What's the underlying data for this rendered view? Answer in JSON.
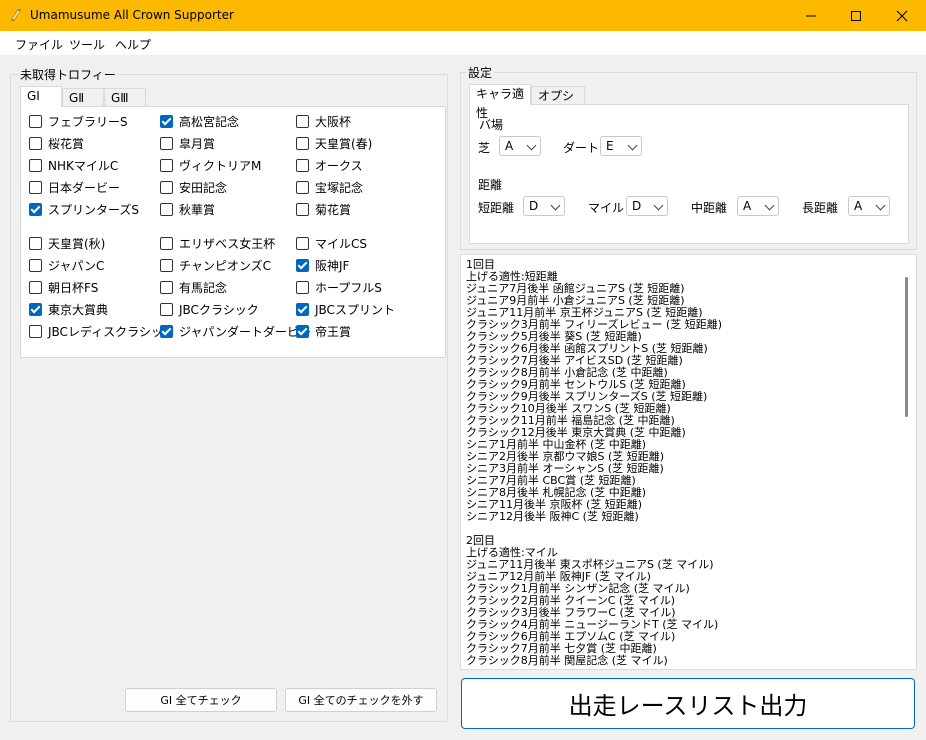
{
  "window": {
    "title": "Umamusume All Crown Supporter"
  },
  "menu": [
    "ファイル",
    "ツール",
    "ヘルプ"
  ],
  "trophy_group": {
    "label": "未取得トロフィー",
    "tabs": [
      "GⅠ",
      "GⅡ",
      "GⅢ"
    ],
    "active_tab": 0,
    "checkboxes": [
      {
        "label": "フェブラリーS",
        "checked": false
      },
      {
        "label": "高松宮記念",
        "checked": true
      },
      {
        "label": "大阪杯",
        "checked": false
      },
      {
        "label": "桜花賞",
        "checked": false
      },
      {
        "label": "皐月賞",
        "checked": false
      },
      {
        "label": "天皇賞(春)",
        "checked": false
      },
      {
        "label": "NHKマイルC",
        "checked": false
      },
      {
        "label": "ヴィクトリアM",
        "checked": false
      },
      {
        "label": "オークス",
        "checked": false
      },
      {
        "label": "日本ダービー",
        "checked": false
      },
      {
        "label": "安田記念",
        "checked": false
      },
      {
        "label": "宝塚記念",
        "checked": false
      },
      {
        "label": "スプリンターズS",
        "checked": true
      },
      {
        "label": "秋華賞",
        "checked": false
      },
      {
        "label": "菊花賞",
        "checked": false
      },
      {
        "label": "天皇賞(秋)",
        "checked": false
      },
      {
        "label": "エリザベス女王杯",
        "checked": false
      },
      {
        "label": "マイルCS",
        "checked": false
      },
      {
        "label": "ジャパンC",
        "checked": false
      },
      {
        "label": "チャンピオンズC",
        "checked": false
      },
      {
        "label": "阪神JF",
        "checked": true
      },
      {
        "label": "朝日杯FS",
        "checked": false
      },
      {
        "label": "有馬記念",
        "checked": false
      },
      {
        "label": "ホープフルS",
        "checked": false
      },
      {
        "label": "東京大賞典",
        "checked": true
      },
      {
        "label": "JBCクラシック",
        "checked": false
      },
      {
        "label": "JBCスプリント",
        "checked": true
      },
      {
        "label": "JBCレディスクラシック",
        "checked": false
      },
      {
        "label": "ジャパンダートダービー",
        "checked": true
      },
      {
        "label": "帝王賞",
        "checked": true
      }
    ],
    "check_all_label": "GⅠ 全てチェック",
    "uncheck_all_label": "GⅠ 全てのチェックを外す"
  },
  "settings": {
    "label": "設定",
    "tabs": [
      "キャラ適性",
      "オプション"
    ],
    "active_tab": 0,
    "track_label": "バ場",
    "turf_label": "芝",
    "turf_value": "A",
    "dirt_label": "ダート",
    "dirt_value": "E",
    "distance_label": "距離",
    "sprint_label": "短距離",
    "sprint_value": "D",
    "mile_label": "マイル",
    "mile_value": "D",
    "medium_label": "中距離",
    "medium_value": "A",
    "long_label": "長距離",
    "long_value": "A"
  },
  "output_lines": [
    "1回目",
    "上げる適性:短距離",
    "ジュニア7月後半 函館ジュニアS (芝 短距離)",
    "ジュニア9月前半 小倉ジュニアS (芝 短距離)",
    "ジュニア11月前半 京王杯ジュニアS (芝 短距離)",
    "クラシック3月前半 フィリーズレビュー (芝 短距離)",
    "クラシック5月後半 葵S (芝 短距離)",
    "クラシック6月後半 函館スプリントS (芝 短距離)",
    "クラシック7月後半 アイビスSD (芝 短距離)",
    "クラシック8月前半 小倉記念 (芝 中距離)",
    "クラシック9月前半 セントウルS (芝 短距離)",
    "クラシック9月後半 スプリンターズS (芝 短距離)",
    "クラシック10月後半 スワンS (芝 短距離)",
    "クラシック11月前半 福島記念 (芝 中距離)",
    "クラシック12月後半 東京大賞典 (芝 中距離)",
    "シニア1月前半 中山金杯 (芝 中距離)",
    "シニア2月後半 京都ウマ娘S (芝 短距離)",
    "シニア3月前半 オーシャンS (芝 短距離)",
    "シニア7月前半 CBC賞 (芝 短距離)",
    "シニア8月後半 札幌記念 (芝 中距離)",
    "シニア11月後半 京阪杯 (芝 短距離)",
    "シニア12月後半 阪神C (芝 短距離)",
    "",
    "2回目",
    "上げる適性:マイル",
    "ジュニア11月後半 東スポ杯ジュニアS (芝 マイル)",
    "ジュニア12月前半 阪神JF (芝 マイル)",
    "クラシック1月前半 シンザン記念 (芝 マイル)",
    "クラシック2月前半 クイーンC (芝 マイル)",
    "クラシック3月後半 フラワーC (芝 マイル)",
    "クラシック4月前半 ニュージーランドT (芝 マイル)",
    "クラシック6月前半 エプソムC (芝 マイル)",
    "クラシック7月前半 七夕賞 (芝 中距離)",
    "クラシック8月前半 関屋記念 (芝 マイル)"
  ],
  "output_button_label": "出走レースリスト出力"
}
